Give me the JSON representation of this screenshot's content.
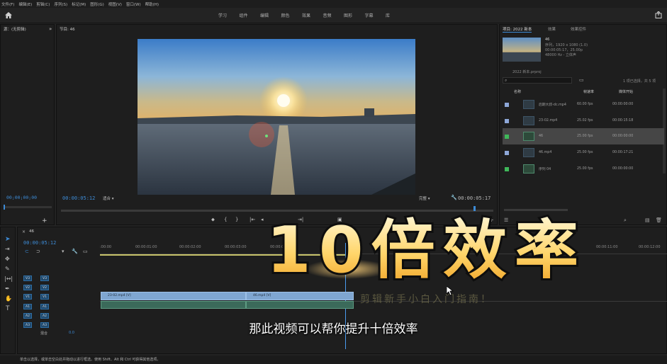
{
  "menu": [
    "文件(F)",
    "编辑(E)",
    "剪辑(C)",
    "序列(S)",
    "标记(M)",
    "图形(G)",
    "视图(V)",
    "窗口(W)",
    "帮助(H)"
  ],
  "workspaces": [
    "学习",
    "组件",
    "编辑",
    "颜色",
    "效果",
    "音频",
    "图形",
    "字幕",
    "库"
  ],
  "source": {
    "title": "源：(无剪辑)",
    "timecode": "00;00;00;00"
  },
  "program": {
    "title": "节目: 46",
    "timecode_left": "00:00:05:12",
    "fit": "适合",
    "quality": "完整",
    "timecode_right": "00:00:05:17"
  },
  "project": {
    "tabs": [
      "项目: 2022 新本",
      "效果",
      "效果控件"
    ],
    "seq_name": "46",
    "seq_info1": "序列，1920 x 1080 (1.0)",
    "seq_info2": "00:00:05:17，25.00p",
    "seq_info3": "48000 Hz - 立体声",
    "file": "2022 新本.prproj",
    "selection": "1 项已选择，共 5 项",
    "headers": [
      "名称",
      "帧速率",
      "媒体开始"
    ],
    "items": [
      {
        "name": "后期大叔-dc.mp4",
        "rate": "60.00 fps",
        "start": "00:00:00:00",
        "color": "#8ea7d8"
      },
      {
        "name": "23-02.mp4",
        "rate": "25.02 fps",
        "start": "00:00:15:18",
        "color": "#8ea7d8"
      },
      {
        "name": "46",
        "rate": "25.00 fps",
        "start": "00:00:00:00",
        "color": "#3fb85a"
      },
      {
        "name": "46.mp4",
        "rate": "25.00 fps",
        "start": "00:00:17:21",
        "color": "#8ea7d8"
      },
      {
        "name": "序列 04",
        "rate": "25.00 fps",
        "start": "00:00:00:00",
        "color": "#3fb85a"
      }
    ]
  },
  "timeline": {
    "tab": "46",
    "timecode": "00:00:05:12",
    "ruler": [
      ":00:00",
      "00:00:01:00",
      "00:00:02:00",
      "00:00:03:00",
      "00:00:04:00",
      "00:00:11:00",
      "00:00:12:00"
    ],
    "tracks": [
      "V3",
      "V2",
      "V1",
      "A1",
      "A2",
      "A3"
    ],
    "mix": "混合",
    "mix_value": "0.0",
    "clip1": "23-02.mp4 [V]",
    "clip2": "46.mp4 [V]"
  },
  "overlay": {
    "title": "10倍效率",
    "banner": "剪辑新手小白入门指南！",
    "subtitle": "那此视频可以帮你提升十倍效率"
  },
  "status": "单击以选择，或单击空白处并拖动以进行框选。使用 Shift、Alt 和 Ctrl 可获得其他选项。"
}
